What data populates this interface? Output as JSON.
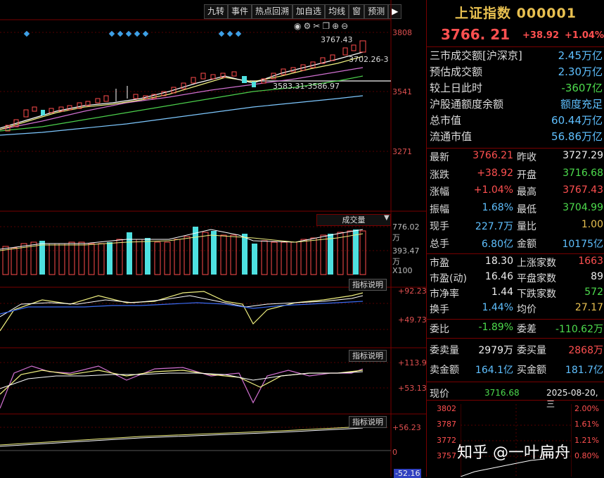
{
  "toolbar": [
    "九转",
    "事件",
    "热点回溯",
    "加自选",
    "均线",
    "窗",
    "预测"
  ],
  "toolbar_play": "▶",
  "main_axis": {
    "top": "3808",
    "mid": "3541",
    "low": "3271"
  },
  "annotations": {
    "high": "3767.43",
    "mid": "3702.26-3",
    "range": "3583.31-3586.97"
  },
  "volume_panel": {
    "title": "成交量",
    "max": "776.02万",
    "mid": "393.47万",
    "unit": "X100"
  },
  "ind1": {
    "title": "指标说明",
    "top": "+92.23",
    "bottom": "+49.73"
  },
  "ind2": {
    "title": "指标说明",
    "top": "+113.9",
    "bottom": "+53.13"
  },
  "ind3": {
    "title": "指标说明",
    "top": "+56.23",
    "zero": "0",
    "bottom": "-52.16"
  },
  "side": {
    "title": "上证指数 000001",
    "price": "3766. 21",
    "change": "+38.92",
    "pct": "+1.04%",
    "stats": [
      {
        "label": "三市成交额[沪深京]",
        "value": "2.45万亿",
        "color": "blue"
      },
      {
        "label": "预估成交额",
        "value": "2.30万亿",
        "color": "blue"
      },
      {
        "label": "较上日此时",
        "value": "-3607亿",
        "color": "green"
      },
      {
        "label": "沪股通额度余额",
        "value": "额度充足",
        "color": "blue"
      },
      {
        "label": "总市值",
        "value": "60.44万亿",
        "color": "blue"
      },
      {
        "label": "流通市值",
        "value": "56.86万亿",
        "color": "blue"
      }
    ],
    "quotes": [
      [
        "最新",
        "3766.21",
        "red",
        "昨收",
        "3727.29",
        "white"
      ],
      [
        "涨跌",
        "+38.92",
        "red",
        "开盘",
        "3716.68",
        "green"
      ],
      [
        "涨幅",
        "+1.04%",
        "red",
        "最高",
        "3767.43",
        "red"
      ],
      [
        "振幅",
        "1.68%",
        "blue",
        "最低",
        "3704.99",
        "green"
      ],
      [
        "现手",
        "227.7万",
        "blue",
        "量比",
        "1.00",
        "yellow"
      ],
      [
        "总手",
        "6.80亿",
        "blue",
        "金额",
        "10175亿",
        "blue"
      ]
    ],
    "quotes2": [
      [
        "市盈",
        "18.30",
        "white",
        "上涨家数",
        "1663",
        "red"
      ],
      [
        "市盈(动)",
        "16.46",
        "white",
        "平盘家数",
        "89",
        "white"
      ],
      [
        "市净率",
        "1.44",
        "white",
        "下跌家数",
        "572",
        "green"
      ],
      [
        "换手",
        "1.44%",
        "blue",
        "均价",
        "27.17",
        "yellow"
      ]
    ],
    "wei": [
      "委比",
      "-1.89%",
      "green",
      "委差",
      "-110.62万",
      "green"
    ],
    "vols": [
      [
        "委卖量",
        "2979万",
        "white",
        "委买量",
        "2868万",
        "red"
      ],
      [
        "卖金额",
        "164.1亿",
        "blue",
        "买金额",
        "181.7亿",
        "blue"
      ]
    ],
    "current": {
      "label": "现价",
      "value": "3716.68",
      "date": "2025-08-20,三"
    },
    "mini_axis_left": [
      "3802",
      "3787",
      "3772",
      "3757"
    ],
    "mini_axis_right": [
      "2.00%",
      "1.61%",
      "1.21%",
      "0.80%"
    ]
  },
  "watermark": "知乎 @一叶扁舟"
}
